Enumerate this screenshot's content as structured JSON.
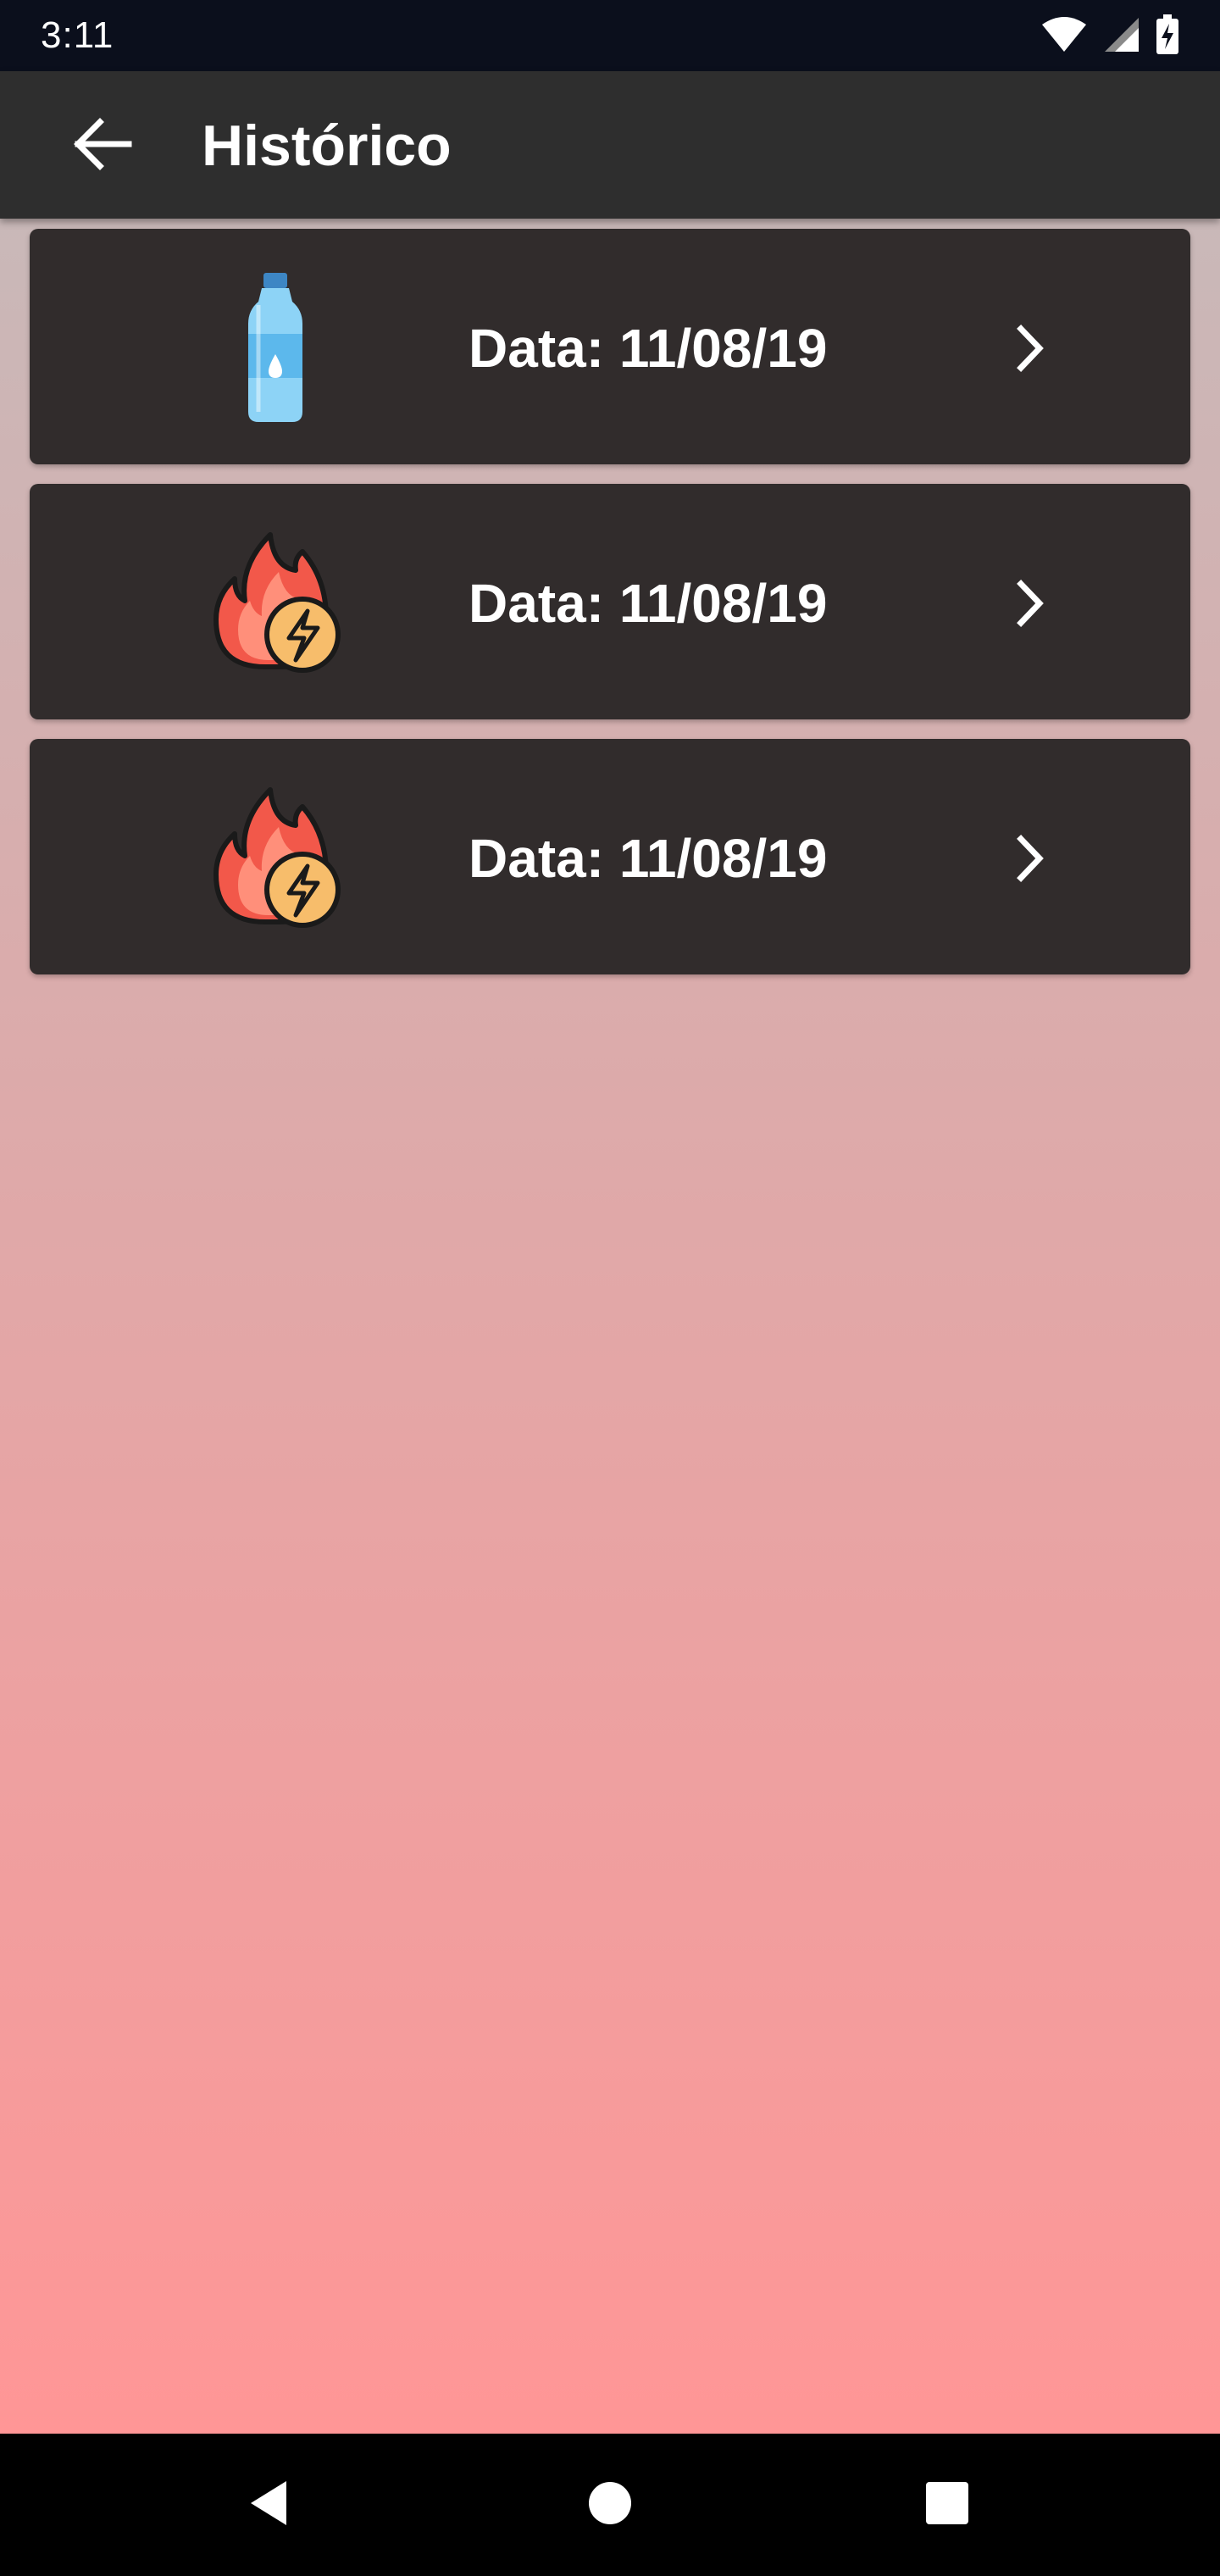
{
  "status_bar": {
    "time": "3:11",
    "icons": [
      "wifi-icon",
      "signal-icon",
      "battery-charging-icon"
    ]
  },
  "app_bar": {
    "back_icon": "arrow-left-icon",
    "title": "Histórico"
  },
  "history": {
    "items": [
      {
        "icon": "water-bottle-icon",
        "label": "Data: 11/08/19"
      },
      {
        "icon": "calorie-fire-icon",
        "label": "Data: 11/08/19"
      },
      {
        "icon": "calorie-fire-icon",
        "label": "Data: 11/08/19"
      }
    ]
  },
  "nav_bar": {
    "icons": [
      "nav-back-icon",
      "nav-home-icon",
      "nav-recents-icon"
    ]
  },
  "colors": {
    "app_bar": "#2e2e2e",
    "card": "#312c2c",
    "gradient_top": "#c9b8b8",
    "gradient_bottom": "#ff9696"
  }
}
